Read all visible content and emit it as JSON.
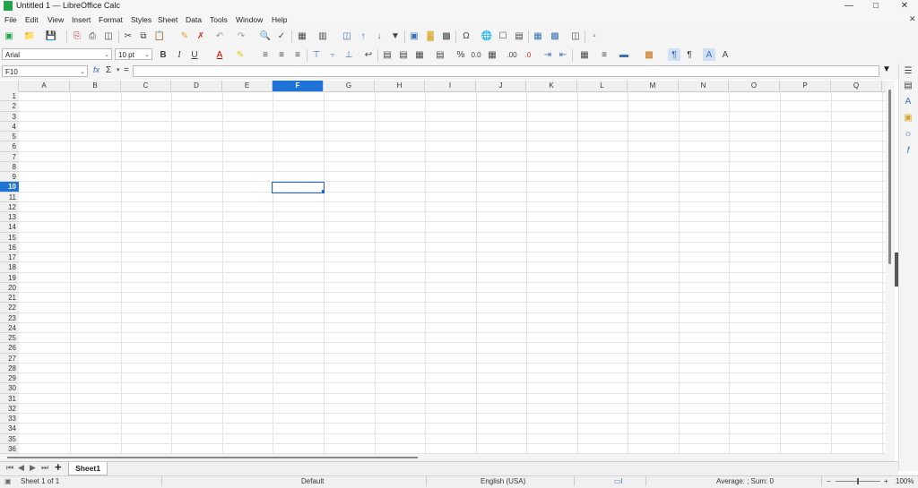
{
  "window": {
    "title": "Untitled 1 — LibreOffice Calc"
  },
  "menu": [
    "File",
    "Edit",
    "View",
    "Insert",
    "Format",
    "Styles",
    "Sheet",
    "Data",
    "Tools",
    "Window",
    "Help"
  ],
  "format_bar": {
    "font_name": "Arial",
    "font_size": "10 pt"
  },
  "formula_bar": {
    "name_box": "F10",
    "formula": "",
    "sum_symbol": "Σ",
    "equals": "=",
    "fx": "fx"
  },
  "columns": [
    "A",
    "B",
    "C",
    "D",
    "E",
    "F",
    "G",
    "H",
    "I",
    "J",
    "K",
    "L",
    "M",
    "N",
    "O",
    "P",
    "Q"
  ],
  "selected_column": "F",
  "rows": [
    "1",
    "2",
    "3",
    "4",
    "5",
    "6",
    "7",
    "8",
    "9",
    "10",
    "11",
    "12",
    "13",
    "14",
    "15",
    "16",
    "17",
    "18",
    "19",
    "20",
    "21",
    "22",
    "23",
    "24",
    "25",
    "26",
    "27",
    "28",
    "29",
    "30",
    "31",
    "32",
    "33",
    "34",
    "35",
    "36"
  ],
  "selected_row": "10",
  "sheet_tab": {
    "name": "Sheet1"
  },
  "status": {
    "sheet": "Sheet 1 of 1",
    "page_style": "Default",
    "language": "English (USA)",
    "summary": "Average: ; Sum: 0",
    "zoom": "100%"
  },
  "colors": {
    "accent": "#1e73d6",
    "app_icon": "#23a249"
  }
}
